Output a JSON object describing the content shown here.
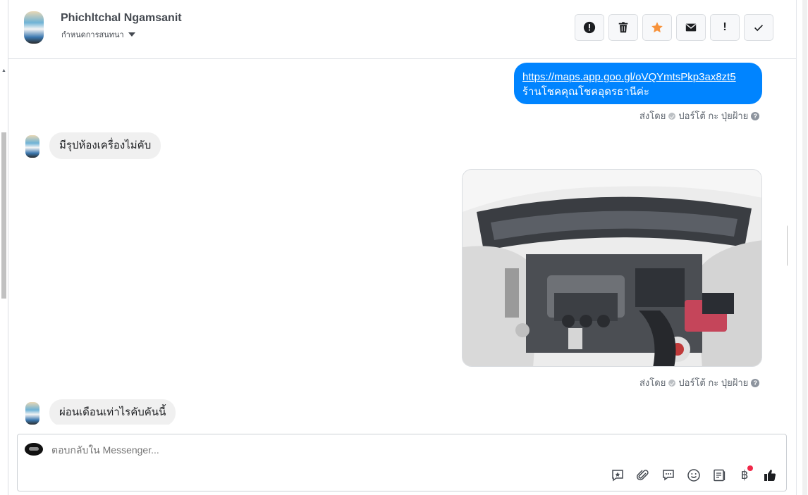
{
  "header": {
    "contact_name": "Phichltchal Ngamsanit",
    "assign_label": "กำหนดการสนทนา",
    "actions": [
      {
        "icon": "alert-circle-icon"
      },
      {
        "icon": "trash-icon"
      },
      {
        "icon": "star-icon",
        "color": "#f7923b"
      },
      {
        "icon": "envelope-icon"
      },
      {
        "icon": "exclamation-icon",
        "glyph": "!"
      },
      {
        "icon": "checkmark-icon"
      }
    ]
  },
  "messages": {
    "outgoing_link": "https://maps.app.goo.gl/oVQYmtsPkp3ax8zt5",
    "outgoing_text": "ร้านโชคคุณโชคอุดรธานีค่ะ",
    "sent_by_label": "ส่งโดย",
    "sender_name": "ปอร์โต้ กะ ปุ่ยฝ้าย",
    "incoming_1": "มีรุปห้องเครื่องไม่คับ",
    "incoming_2": "ผ่อนเดือนเท่าไรคับคันนี้",
    "photo_icon": "car-engine-photo"
  },
  "composer": {
    "placeholder": "ตอบกลับใน Messenger...",
    "tools": [
      "saved-reply-icon",
      "paperclip-icon",
      "chat-bubble-icon",
      "emoji-icon",
      "note-icon",
      "baht-icon",
      "like-icon"
    ],
    "baht_glyph": "฿"
  },
  "colors": {
    "accent": "#0084ff",
    "incoming_bubble": "#f0f0f0",
    "notification_dot": "#f02849"
  }
}
